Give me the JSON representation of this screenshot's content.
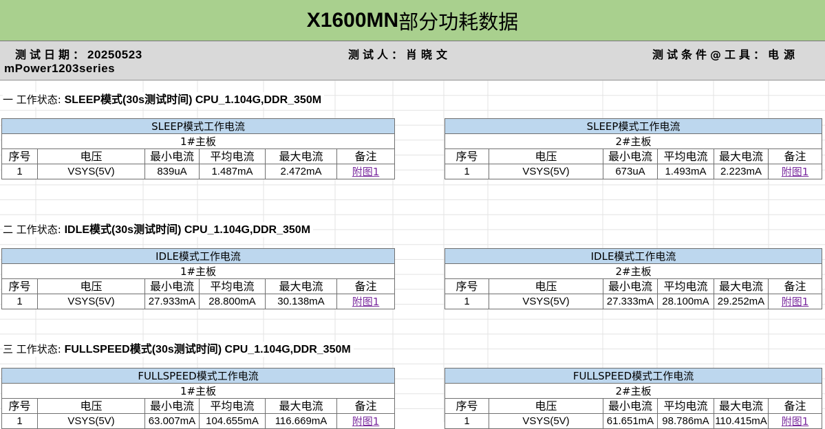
{
  "title": {
    "latin": "X1600MN",
    "cn": "部分功耗数据"
  },
  "info": {
    "date_label": "测试日期：",
    "date_value": "20250523",
    "tester_label": "测试人：",
    "tester_value": "肖晓文",
    "condition_label": "测试条件@工具：",
    "condition_value": "电源",
    "device": "mPower1203series"
  },
  "columns": [
    "序号",
    "电压",
    "最小电流",
    "平均电流",
    "最大电流",
    "备注"
  ],
  "sections": [
    {
      "title_prefix": "一  工作状态: ",
      "title_bold": "SLEEP模式(30s测试时间)  CPU_1.104G,DDR_350M",
      "mode_header": "SLEEP模式工作电流",
      "boards": [
        {
          "board": "1#主板",
          "row": {
            "no": "1",
            "voltage": "VSYS(5V)",
            "min": "839uA",
            "avg": "1.487mA",
            "max": "2.472mA",
            "note": "附图1"
          }
        },
        {
          "board": "2#主板",
          "row": {
            "no": "1",
            "voltage": "VSYS(5V)",
            "min": "673uA",
            "avg": "1.493mA",
            "max": "2.223mA",
            "note": "附图1"
          }
        }
      ]
    },
    {
      "title_prefix": "二  工作状态: ",
      "title_bold": "IDLE模式(30s测试时间)  CPU_1.104G,DDR_350M",
      "mode_header": "IDLE模式工作电流",
      "boards": [
        {
          "board": "1#主板",
          "row": {
            "no": "1",
            "voltage": "VSYS(5V)",
            "min": "27.933mA",
            "avg": "28.800mA",
            "max": "30.138mA",
            "note": "附图1"
          }
        },
        {
          "board": "2#主板",
          "row": {
            "no": "1",
            "voltage": "VSYS(5V)",
            "min": "27.333mA",
            "avg": "28.100mA",
            "max": "29.252mA",
            "note": "附图1"
          }
        }
      ]
    },
    {
      "title_prefix": "三  工作状态: ",
      "title_bold": "FULLSPEED模式(30s测试时间)  CPU_1.104G,DDR_350M",
      "mode_header": "FULLSPEED模式工作电流",
      "boards": [
        {
          "board": "1#主板",
          "row": {
            "no": "1",
            "voltage": "VSYS(5V)",
            "min": "63.007mA",
            "avg": "104.655mA",
            "max": "116.669mA",
            "note": "附图1"
          }
        },
        {
          "board": "2#主板",
          "row": {
            "no": "1",
            "voltage": "VSYS(5V)",
            "min": "61.651mA",
            "avg": "98.786mA",
            "max": "110.415mA",
            "note": "附图1"
          }
        }
      ]
    }
  ],
  "colors": {
    "title_bg": "#a9d08e",
    "info_bg": "#d9d9d9",
    "table_header_bg": "#bdd7ee",
    "link": "#7a2a9e"
  }
}
